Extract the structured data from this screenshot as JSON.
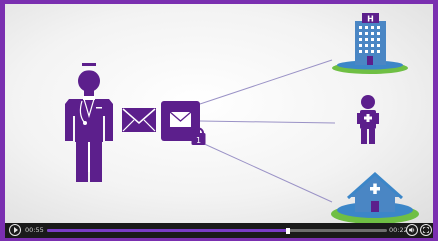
{
  "player": {
    "elapsed": "00:55",
    "remaining": "00:22",
    "progress": 0.71,
    "accent_color": "#7a2fb0",
    "controls": {
      "play_icon": "play-icon",
      "volume_icon": "volume-icon",
      "fullscreen_icon": "fullscreen-icon"
    }
  },
  "scene": {
    "colors": {
      "purple": "#5c1f8c",
      "building_blue": "#4a86c4",
      "ground_green": "#6fbf44",
      "ground_blue": "#3c86c8",
      "line": "#9a92c6"
    },
    "hospital_sign": "H",
    "lock_badge": "1"
  }
}
